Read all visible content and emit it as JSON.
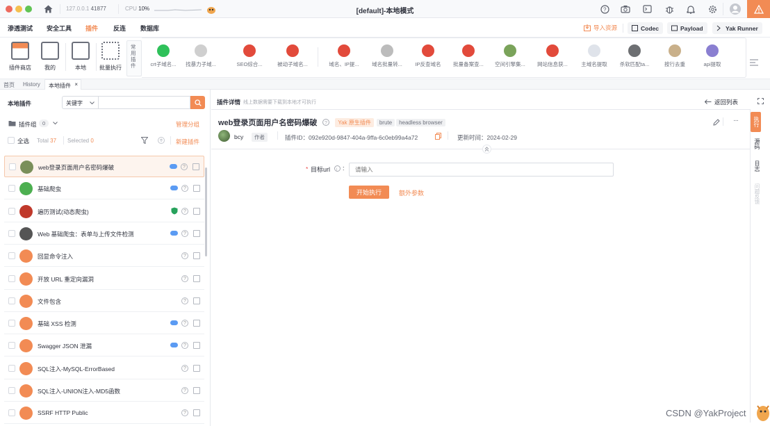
{
  "titlebar": {
    "host": "127.0.0.1",
    "port": "41877",
    "cpu_label": "CPU",
    "cpu_value": "10%",
    "window_title": "[default]-本地模式"
  },
  "menubar": {
    "items": [
      "渗透测试",
      "安全工具",
      "插件",
      "反连",
      "数据库"
    ],
    "active": "插件",
    "import_label": "导入资源",
    "codec_label": "Codec",
    "payload_label": "Payload",
    "runner_label": "Yak Runner"
  },
  "toolbar": {
    "tools": [
      "插件商店",
      "我的",
      "本地",
      "批量执行"
    ],
    "common_label": "常用插件",
    "plugins": [
      "crt子域名...",
      "找暴力子域...",
      "SEO综合...",
      "被动子域名...",
      "域名、IP提...",
      "域名批量转...",
      "IP反查域名",
      "批量备案查...",
      "空间引擎集...",
      "网站信息获...",
      "主域名提取",
      "杀软匹配ta...",
      "按行去重",
      "api提取"
    ]
  },
  "tabs": {
    "items": [
      "首页",
      "History",
      "本地插件"
    ],
    "close": "×"
  },
  "left": {
    "title": "本地插件",
    "search_type": "关键字",
    "group_label": "插件组",
    "group_count": "0",
    "manage_group": "管理分组",
    "select_all": "全选",
    "total_label": "Total",
    "total_value": "37",
    "selected_label": "Selected",
    "selected_value": "0",
    "new_plugin": "新建插件",
    "plugins": [
      {
        "name": "web登录页面用户名密码爆破"
      },
      {
        "name": "基础爬虫"
      },
      {
        "name": "遍历测试(动态爬虫)"
      },
      {
        "name": "Web 基础爬虫：表单与上传文件检测"
      },
      {
        "name": "回显命令注入"
      },
      {
        "name": "开放 URL 重定向漏洞"
      },
      {
        "name": "文件包含"
      },
      {
        "name": "基础 XSS 检测"
      },
      {
        "name": "Swagger JSON 泄漏"
      },
      {
        "name": "SQL注入-MySQL-ErrorBased"
      },
      {
        "name": "SQL注入-UNION注入-MD5函数"
      },
      {
        "name": "SSRF HTTP Public"
      }
    ]
  },
  "detail": {
    "header_label": "插件详情",
    "header_hint": "线上数据需要下载到本地才可执行",
    "back_label": "返回列表",
    "plugin_title": "web登录页面用户名密码爆破",
    "tags": [
      "Yak 原生插件",
      "brute",
      "headless browser"
    ],
    "author_name": "bcy",
    "author_role": "作者",
    "plugin_id_label": "插件ID：",
    "plugin_id": "092e920d-9847-404a-9ffa-6c0eb99a4a72",
    "updated_label": "更新时间：",
    "updated_value": "2024-02-29",
    "field_label": "目标url",
    "field_required": "*",
    "field_placeholder": "请输入",
    "run_button": "开始执行",
    "extra_params": "额外参数"
  },
  "side_tabs": [
    "执行",
    "源码",
    "日志",
    "问题反馈"
  ],
  "watermark": "CSDN @YakProject",
  "colors": {
    "accent": "#f28b54"
  }
}
